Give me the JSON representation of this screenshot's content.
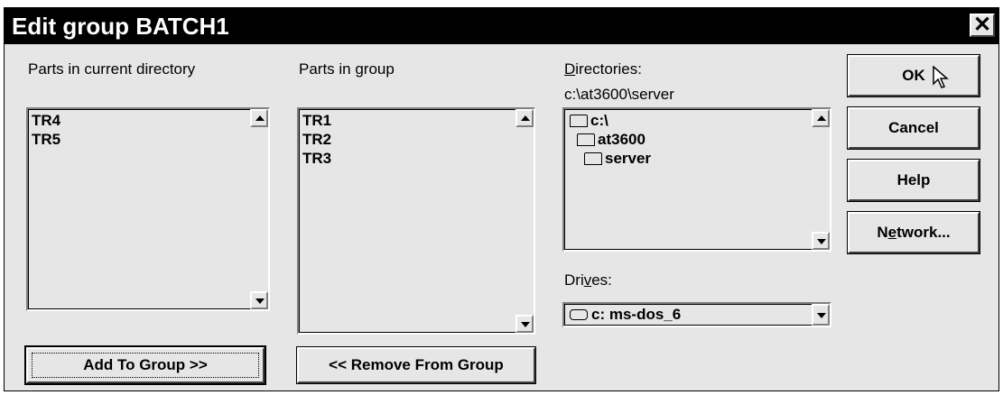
{
  "window": {
    "title": "Edit group BATCH1",
    "close_glyph": "✕"
  },
  "parts_current": {
    "label": "Parts in current directory",
    "items": [
      "TR4",
      "TR5"
    ]
  },
  "parts_group": {
    "label": "Parts in group",
    "items": [
      "TR1",
      "TR2",
      "TR3"
    ]
  },
  "directories": {
    "label_first": "D",
    "label_rest": "irectories:",
    "current_path": "c:\\at3600\\server",
    "tree": [
      "c:\\",
      "at3600",
      "server"
    ]
  },
  "drives": {
    "label_pre": "Dri",
    "label_u": "v",
    "label_post": "es:",
    "selected": "c: ms-dos_6"
  },
  "buttons": {
    "ok": "OK",
    "cancel": "Cancel",
    "help": "Help",
    "network_pre": "N",
    "network_u": "e",
    "network_post": "twork...",
    "add": "Add To Group >>",
    "remove": "<< Remove From Group"
  },
  "icons": {
    "close": "close-icon",
    "scroll_up": "scroll-up-arrow-icon",
    "scroll_down": "scroll-down-arrow-icon",
    "folder_open": "open-folder-icon",
    "drive": "drive-icon",
    "cursor": "mouse-pointer-icon"
  }
}
